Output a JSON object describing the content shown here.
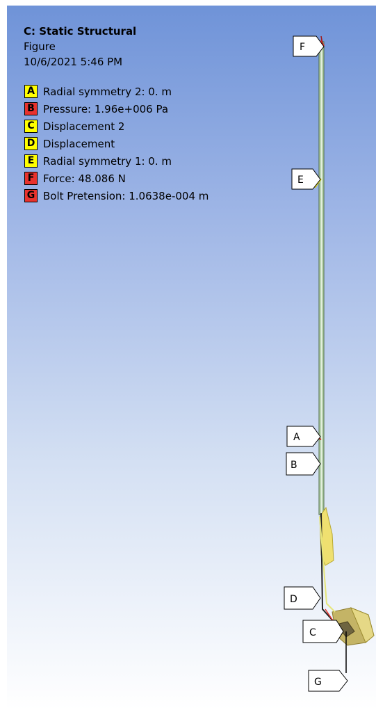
{
  "header": {
    "title": "C: Static Structural",
    "subtitle": "Figure",
    "timestamp": "10/6/2021 5:46 PM"
  },
  "legend": [
    {
      "letter": "A",
      "label": "Radial symmetry 2: 0. m",
      "color": "#ffff00"
    },
    {
      "letter": "B",
      "label": "Pressure: 1.96e+006 Pa",
      "color": "#e8322d"
    },
    {
      "letter": "C",
      "label": "Displacement 2",
      "color": "#ffff00"
    },
    {
      "letter": "D",
      "label": "Displacement",
      "color": "#ffff00"
    },
    {
      "letter": "E",
      "label": "Radial symmetry 1: 0. m",
      "color": "#ffff00"
    },
    {
      "letter": "F",
      "label": "Force: 48.086 N",
      "color": "#e8322d"
    },
    {
      "letter": "G",
      "label": "Bolt Pretension: 1.0638e-004 m",
      "color": "#e8322d"
    }
  ],
  "tags": {
    "F": "F",
    "E": "E",
    "A": "A",
    "B": "B",
    "D": "D",
    "C": "C",
    "G": "G"
  },
  "colors": {
    "viewport_top": "#6f93d8",
    "viewport_bottom": "#ffffff",
    "shaft": "#b9d3b0",
    "yellow": "#ffff00",
    "red": "#e8322d"
  }
}
